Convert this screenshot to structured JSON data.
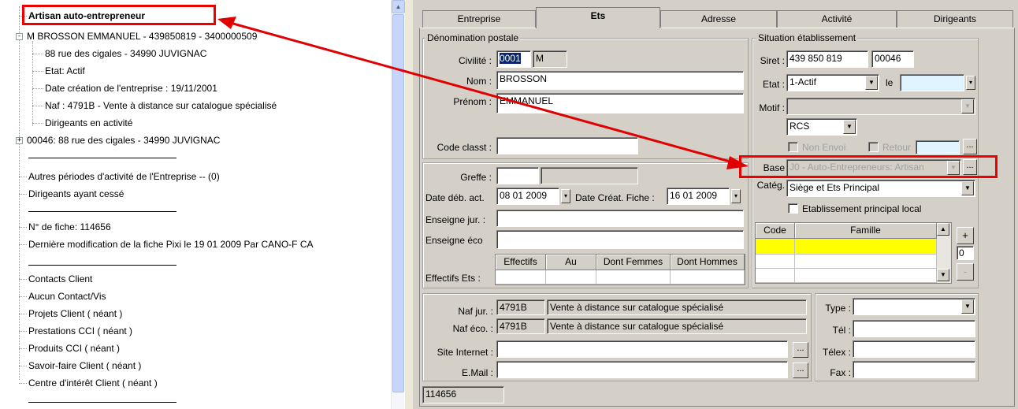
{
  "tree": {
    "root_label": "Artisan auto-entrepreneur",
    "company_node": "M BROSSON EMMANUEL - 439850819 - 3400000509",
    "company_details": [
      "88 rue des cigales - 34990 JUVIGNAC",
      "Etat: Actif",
      "Date création de l'entreprise : 19/11/2001",
      "Naf : 4791B - Vente à distance sur catalogue spécialisé",
      "Dirigeants en activité"
    ],
    "establishment_node": "00046: 88 rue des cigales - 34990 JUVIGNAC",
    "group2": [
      "Autres périodes d'activité de l'Entreprise  -- (0)",
      " Dirigeants ayant cessé"
    ],
    "group3": [
      "N° de fiche: 114656",
      "Dernière modification de la fiche Pixi le  19 01 2009 Par  CANO-F CA"
    ],
    "group4": [
      "Contacts Client",
      "Aucun Contact/Vis",
      "Projets Client ( néant )",
      "Prestations CCI ( néant )",
      "Produits CCI ( néant )",
      "Savoir-faire Client ( néant )",
      "Centre d'intérêt Client ( néant )"
    ],
    "expand_collapsed": "+",
    "expand_open": "-"
  },
  "tabs": [
    "Entreprise",
    "Ets",
    "Adresse",
    "Activité",
    "Dirigeants"
  ],
  "active_tab": "Ets",
  "denomination": {
    "title": "Dénomination postale",
    "civilite_label": "Civilité :",
    "civilite_code": "0001",
    "civilite_value": "M",
    "nom_label": "Nom :",
    "nom_value": "BROSSON",
    "prenom_label": "Prénom :",
    "prenom_value": "EMMANUEL",
    "code_classt_label": "Code classt :",
    "code_classt_value": ""
  },
  "greffe": {
    "greffe_label": "Greffe :",
    "greffe_code": "",
    "greffe_name": "",
    "date_deb_label": "Date déb. act.",
    "date_deb_value": "08 01 2009",
    "date_creat_label": "Date Créat. Fiche :",
    "date_creat_value": "16 01 2009",
    "enseigne_jur_label": "Enseigne jur. :",
    "enseigne_jur_value": "",
    "enseigne_eco_label": "Enseigne éco",
    "enseigne_eco_value": "",
    "effectifs_label": "Effectifs Ets :",
    "effectifs_headers": [
      "Effectifs",
      "Au",
      "Dont Femmes",
      "Dont Hommes"
    ]
  },
  "situation": {
    "title": "Situation établissement",
    "siret_label": "Siret :",
    "siret_value": "439 850 819",
    "siret_suffix": "00046",
    "etat_label": "Etat :",
    "etat_value": "1-Actif",
    "le_label": "le",
    "le_value": "",
    "motif_label": "Motif :",
    "motif_value": "",
    "rcs_value": "RCS",
    "non_envoi_label": "Non Envoi",
    "retour_label": "Retour",
    "base_label": "Base",
    "base_value": "J0 - Auto-Entrepreneurs: Artisan",
    "categ_label": "Catég.",
    "categ_value": "Siège et Ets Principal",
    "etab_principal_label": "Etablissement principal local",
    "grid_headers": [
      "Code",
      "Famille"
    ],
    "counter_value": "0",
    "plus_label": "+",
    "minus_label": "-",
    "ellipsis": "..."
  },
  "naf": {
    "naf_jur_label": "Naf jur. :",
    "naf_jur_code": "4791B",
    "naf_jur_desc": "Vente à distance sur catalogue spécialisé",
    "naf_eco_label": "Naf éco. :",
    "naf_eco_code": "4791B",
    "naf_eco_desc": "Vente à distance sur catalogue spécialisé",
    "site_label": "Site Internet :",
    "site_value": "",
    "email_label": "E.Mail :",
    "email_value": ""
  },
  "contact": {
    "type_label": "Type :",
    "type_value": "",
    "tel_label": "Tél :",
    "telex_label": "Télex :",
    "fax_label": "Fax :"
  },
  "status_value": "114656",
  "colors": {
    "annotation_red": "#e00000",
    "highlight_yellow": "#ffff00",
    "form_gray": "#d4d0c8"
  }
}
